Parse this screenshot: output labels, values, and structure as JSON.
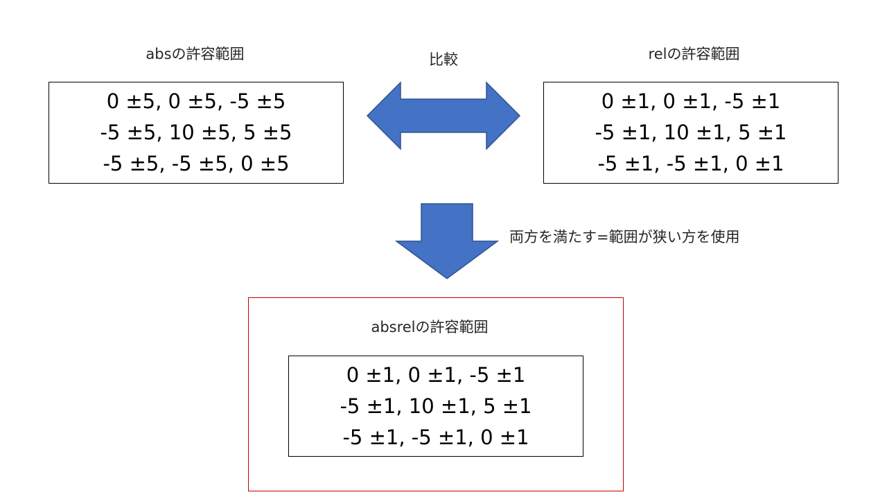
{
  "abs": {
    "title": "absの許容範囲",
    "lines": [
      "0 ±5, 0 ±5, -5 ±5",
      "-5 ±5, 10 ±5, 5 ±5",
      "-5 ±5, -5 ±5, 0 ±5"
    ]
  },
  "rel": {
    "title": "relの許容範囲",
    "lines": [
      "0 ±1, 0 ±1, -5 ±1",
      "-5 ±1, 10 ±1, 5 ±1",
      "-5 ±1, -5 ±1, 0 ±1"
    ]
  },
  "compare_label": "比較",
  "down_label": "両方を満たす=範囲が狭い方を使用",
  "absrel": {
    "title": "absrelの許容範囲",
    "lines": [
      "0 ±1, 0 ±1, -5 ±1",
      "-5 ±1, 10 ±1, 5 ±1",
      "-5 ±1, -5 ±1, 0 ±1"
    ]
  },
  "colors": {
    "arrow_fill": "#4472c4",
    "arrow_stroke": "#2f528f",
    "highlight_border": "#c00000"
  }
}
